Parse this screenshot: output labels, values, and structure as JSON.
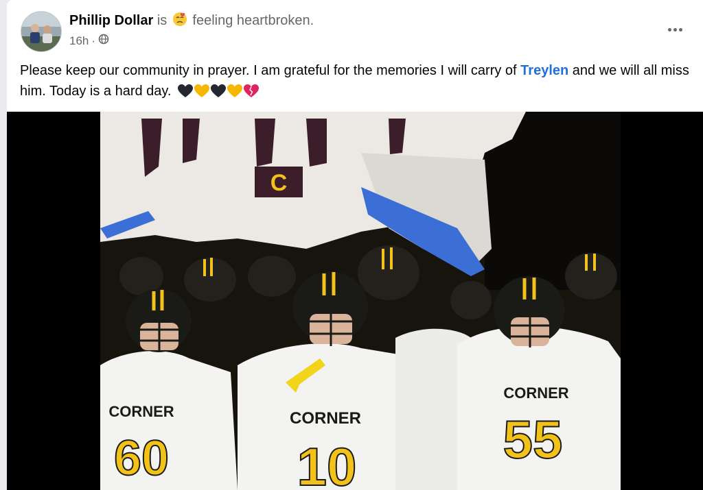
{
  "post": {
    "author": "Phillip Dollar",
    "is_word": "is",
    "feeling": "feeling heartbroken.",
    "time": "16h",
    "dot": "·",
    "text_before": "Please keep our community in prayer. I am grateful for the memories I will carry of ",
    "mention": "Treylen",
    "text_after": " and we will all miss him. Today is a hard day.",
    "heart_colors": [
      "#23272f",
      "#f5b800",
      "#23272f",
      "#f5b800",
      "#e0245e"
    ]
  },
  "photo": {
    "banner_letter": "C",
    "jersey_text": "CORNER",
    "numbers": [
      "60",
      "10",
      "55"
    ],
    "colors": {
      "gold": "#f2c21b",
      "helmet": "#1a1a16",
      "jersey": "#f3f3f1"
    }
  },
  "icons": {
    "globe": "globe-icon",
    "more": "more-options-icon",
    "feeling": "heartbroken-face-icon"
  }
}
